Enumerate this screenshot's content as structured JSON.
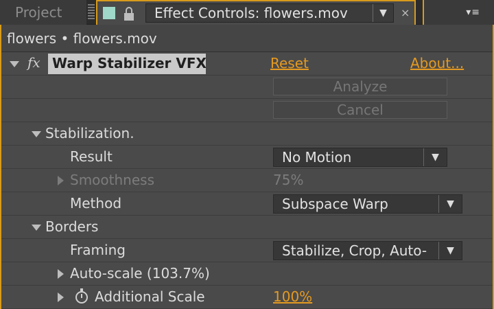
{
  "tabs": {
    "project_label": "Project",
    "effect_controls_label": "Effect Controls: flowers.mov",
    "dropdown_arrow": "▼",
    "close_glyph": "×",
    "menu_glyph": "▾≡"
  },
  "breadcrumb": "flowers • flowers.mov",
  "effect": {
    "fx_glyph": "fx",
    "name": "Warp Stabilizer VFX",
    "reset_label": "Reset",
    "about_label": "About...",
    "analyze_label": "Analyze",
    "cancel_label": "Cancel"
  },
  "properties": {
    "stabilization_label": "Stabilization.",
    "result_label": "Result",
    "result_value": "No Motion",
    "smoothness_label": "Smoothness",
    "smoothness_value": "75%",
    "method_label": "Method",
    "method_value": "Subspace Warp",
    "borders_label": "Borders",
    "framing_label": "Framing",
    "framing_value": "Stabilize, Crop, Auto-",
    "autoscale_label": "Auto-scale (103.7%)",
    "additional_scale_label": "Additional Scale",
    "additional_scale_value": "100%"
  },
  "colors": {
    "accent": "#d99b1a",
    "link": "#e59a20",
    "panel_bg": "#4a4a4a",
    "swatch": "#9fd8c8"
  },
  "icons": {
    "swatch": "color-swatch-icon",
    "lock": "lock-icon",
    "close": "close-icon",
    "menu": "panel-menu-icon",
    "fx": "fx-icon",
    "stopwatch": "stopwatch-icon"
  }
}
